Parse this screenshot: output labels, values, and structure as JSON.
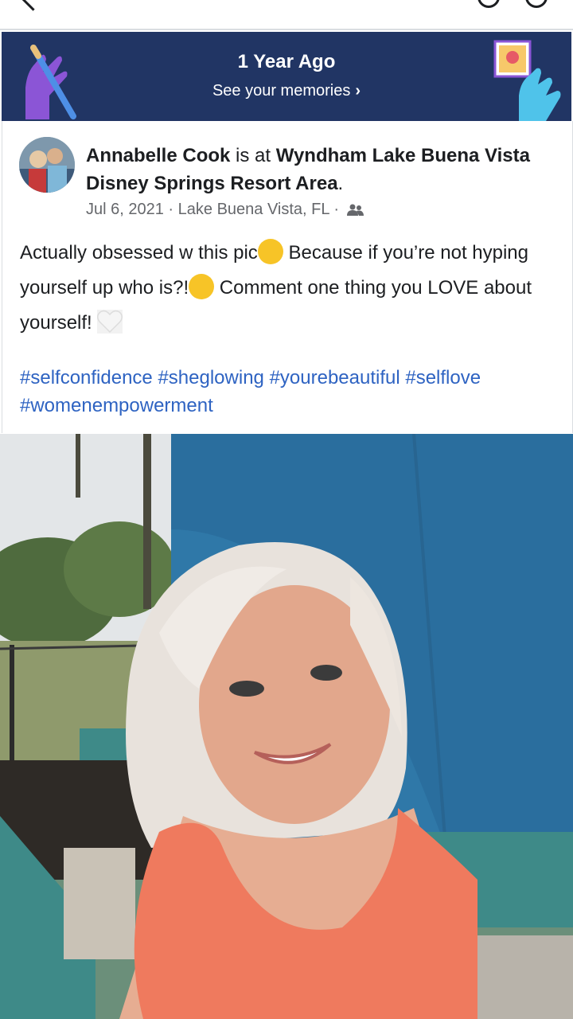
{
  "banner": {
    "title": "1 Year Ago",
    "subtitle": "See your memories",
    "chevron": "›",
    "bg_color": "#213564"
  },
  "post": {
    "author": "Annabelle Cook",
    "verb": " is at ",
    "place": "Wyndham Lake Buena Vista Disney Springs Resort Area",
    "period": ".",
    "date": "Jul 6, 2021",
    "sep": " · ",
    "location": "Lake Buena Vista, FL",
    "audience_icon": "friends-icon",
    "text_1": "Actually obsessed w this pic",
    "text_2": " Because if you’re not hyping yourself up who is?!",
    "text_3": " Comment one thing you LOVE about yourself! ",
    "hashtags": [
      "#selfconfidence",
      "#sheglowing",
      "#yourebeautiful",
      "#selflove",
      "#womenempowerment"
    ],
    "link_color": "#2e63c2"
  }
}
